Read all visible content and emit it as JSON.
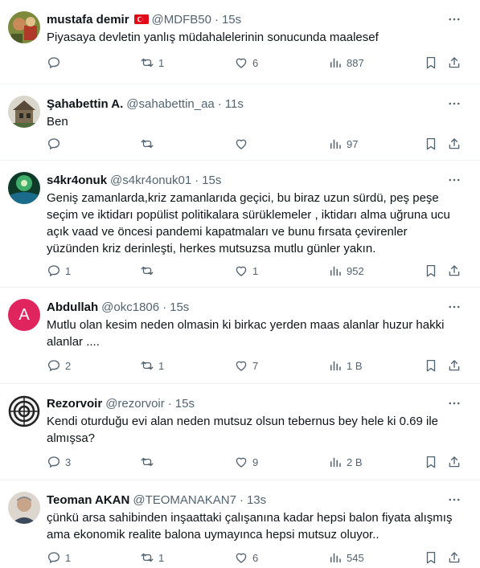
{
  "tweets": [
    {
      "name": "mustafa demir",
      "handle": "@MDFB50",
      "time": "15s",
      "text": "Piyasaya devletin yanlış müdahalelerinin sonucunda maalesef",
      "replies": "",
      "retweets": "1",
      "likes": "6",
      "views": "887",
      "avatar_color": "#6b7a3a",
      "flag": true
    },
    {
      "name": "Şahabettin A.",
      "handle": "@sahabettin_aa",
      "time": "11s",
      "text": "Ben",
      "replies": "",
      "retweets": "",
      "likes": "",
      "views": "97",
      "avatar_color": "#4a5a4a"
    },
    {
      "name": "s4kr4onuk",
      "handle": "@s4kr4onuk01",
      "time": "15s",
      "text": "Geniş zamanlarda,kriz zamanlarıda geçici, bu biraz uzun sürdü, peş peşe seçim ve iktidarı popülist politikalara sürüklemeler , iktidarı alma uğruna ucu açık vaad ve öncesi pandemi kapatmaları ve bunu fırsata çevirenler yüzünden kriz derinleşti, herkes mutsuzsa mutlu günler yakın.",
      "replies": "1",
      "retweets": "",
      "likes": "1",
      "views": "952",
      "avatar_color": "#1e6b4a"
    },
    {
      "name": "Abdullah",
      "handle": "@okc1806",
      "time": "15s",
      "text": "Mutlu olan kesim neden olmasin ki birkac yerden maas alanlar huzur hakki alanlar ....",
      "replies": "2",
      "retweets": "1",
      "likes": "7",
      "views": "1 B",
      "avatar_letter": "A",
      "avatar_color": "#e0245e"
    },
    {
      "name": "Rezorvoir",
      "handle": "@rezorvoir",
      "time": "15s",
      "text": "Kendi oturduğu evi alan neden mutsuz olsun tebernus bey hele ki 0.69 ile almışsa?",
      "replies": "3",
      "retweets": "",
      "likes": "9",
      "views": "2 B",
      "avatar_color": "#222222"
    },
    {
      "name": "Teoman AKAN",
      "handle": "@TEOMANAKAN7",
      "time": "13s",
      "text": "çünkü arsa sahibinden inşaattaki çalışanına kadar hepsi balon fiyata alışmış ama ekonomik realite balona uymayınca hepsi mutsuz oluyor..",
      "replies": "1",
      "retweets": "1",
      "likes": "6",
      "views": "545",
      "avatar_color": "#c9b9a8"
    }
  ],
  "colors": {
    "text": "#0f1419",
    "muted": "#536471",
    "divider": "#eff3f4"
  },
  "icons": [
    "reply-icon",
    "retweet-icon",
    "like-icon",
    "views-icon",
    "bookmark-icon",
    "share-icon",
    "more-icon"
  ]
}
